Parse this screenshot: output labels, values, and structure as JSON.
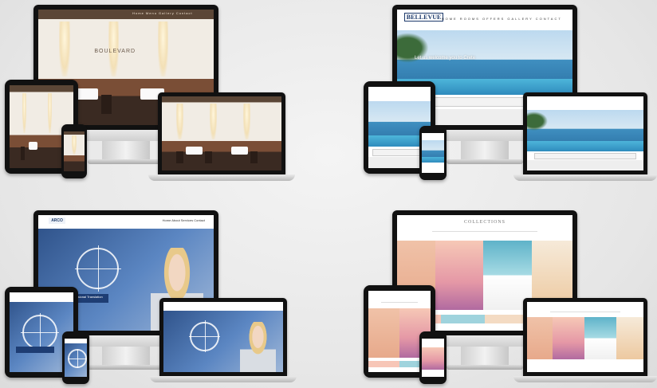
{
  "scene": "Four responsive website mockups, each shown on monitor, laptop, tablet and phone",
  "mockups": [
    {
      "id": "restaurant",
      "nav_text": "Home  Menu  Gallery  Contact",
      "logo_text": "BOULEVARD"
    },
    {
      "id": "hotel",
      "brand": "BELLEVUE",
      "menu_text": "HOME  ROOMS  OFFERS  GALLERY  CONTACT",
      "hero_text": "Let us welcome you to Crete"
    },
    {
      "id": "call-centre",
      "brand": "ARCO",
      "menu_text": "Home  About  Services  Contact",
      "cta_text": "Professional Translation"
    },
    {
      "id": "beauty",
      "title": "COLLECTIONS"
    }
  ]
}
